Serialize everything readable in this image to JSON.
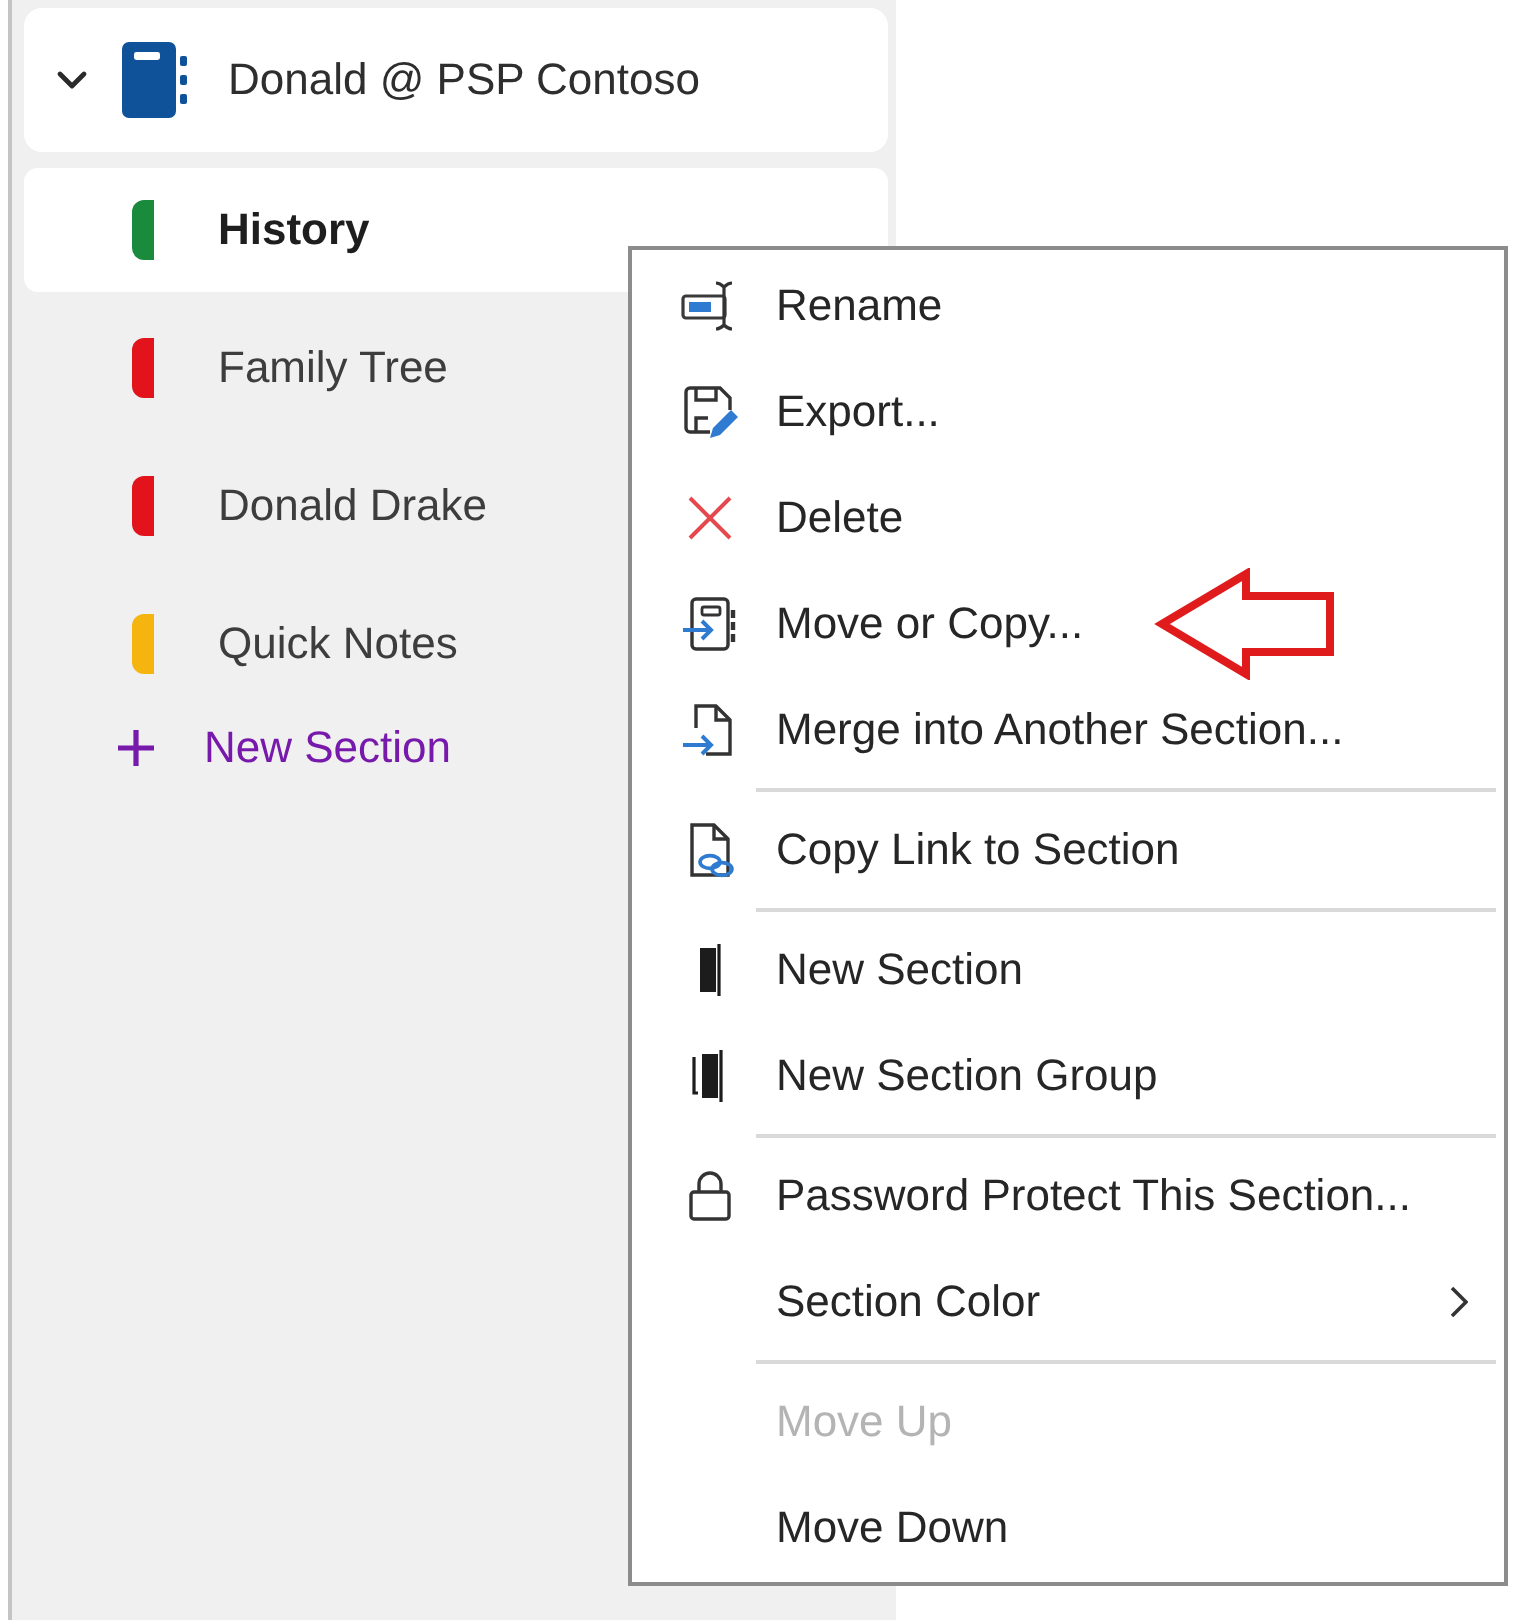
{
  "sidebar": {
    "notebook": {
      "name": "Donald @ PSP Contoso",
      "expanded": true,
      "sections": [
        {
          "name": "History",
          "color": "#1a8a3c",
          "selected": true
        },
        {
          "name": "Family Tree",
          "color": "#e3131b",
          "selected": false
        },
        {
          "name": "Donald Drake",
          "color": "#e3131b",
          "selected": false
        },
        {
          "name": "Quick Notes",
          "color": "#f6b40e",
          "selected": false
        }
      ],
      "new_section": "New Section"
    }
  },
  "context_menu": {
    "groups": [
      [
        {
          "kind": "rename",
          "label": "Rename",
          "disabled": false,
          "submenu": false,
          "arrow_callout": false
        },
        {
          "kind": "export",
          "label": "Export...",
          "disabled": false,
          "submenu": false,
          "arrow_callout": false
        },
        {
          "kind": "delete",
          "label": "Delete",
          "disabled": false,
          "submenu": false,
          "arrow_callout": false
        },
        {
          "kind": "move",
          "label": "Move or Copy...",
          "disabled": false,
          "submenu": false,
          "arrow_callout": true
        },
        {
          "kind": "merge",
          "label": "Merge into Another Section...",
          "disabled": false,
          "submenu": false,
          "arrow_callout": false
        }
      ],
      [
        {
          "kind": "link",
          "label": "Copy Link to Section",
          "disabled": false,
          "submenu": false,
          "arrow_callout": false
        }
      ],
      [
        {
          "kind": "section",
          "label": "New Section",
          "disabled": false,
          "submenu": false,
          "arrow_callout": false
        },
        {
          "kind": "group",
          "label": "New Section Group",
          "disabled": false,
          "submenu": false,
          "arrow_callout": false
        }
      ],
      [
        {
          "kind": "lock",
          "label": "Password Protect This Section...",
          "disabled": false,
          "submenu": false,
          "arrow_callout": false
        },
        {
          "kind": "plain",
          "label": "Section Color",
          "disabled": false,
          "submenu": true,
          "arrow_callout": false
        }
      ],
      [
        {
          "kind": "plain",
          "label": "Move Up",
          "disabled": true,
          "submenu": false,
          "arrow_callout": false
        },
        {
          "kind": "plain",
          "label": "Move Down",
          "disabled": false,
          "submenu": false,
          "arrow_callout": false
        }
      ]
    ]
  }
}
